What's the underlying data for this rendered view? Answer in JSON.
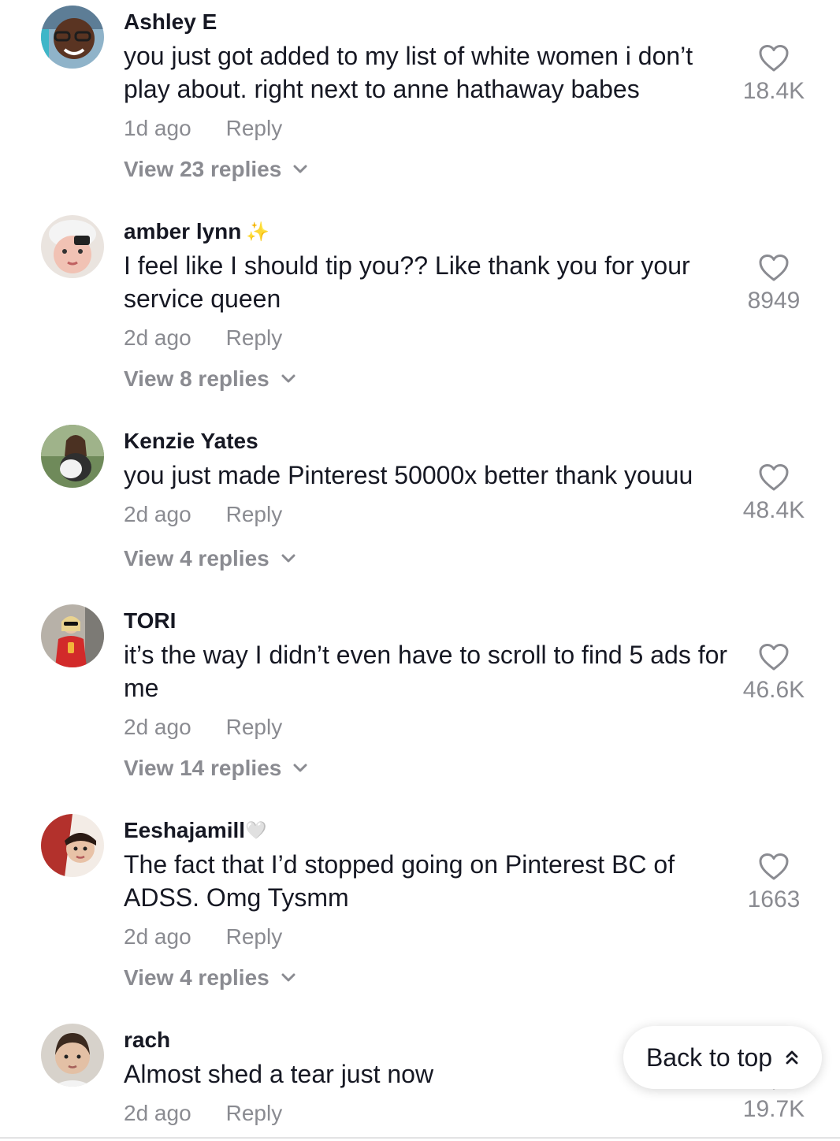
{
  "comments": [
    {
      "username": "Ashley E",
      "badge": "",
      "text": "you just got added to my list of white women i don’t play about. right next to anne hathaway babes",
      "time": "1d ago",
      "reply_label": "Reply",
      "likes": "18.4K",
      "view_replies": "View 23 replies"
    },
    {
      "username": "amber lynn",
      "badge": "✨",
      "text": "I feel like I should tip you?? Like thank you for your service queen",
      "time": "2d ago",
      "reply_label": "Reply",
      "likes": "8949",
      "view_replies": "View 8 replies"
    },
    {
      "username": "Kenzie Yates",
      "badge": "",
      "text": "you just made Pinterest 50000x better thank youuu",
      "time": "2d ago",
      "reply_label": "Reply",
      "likes": "48.4K",
      "view_replies": "View 4 replies"
    },
    {
      "username": "TORI",
      "badge": "",
      "text": "it’s the way I didn’t even have to scroll to find 5 ads for me",
      "time": "2d ago",
      "reply_label": "Reply",
      "likes": "46.6K",
      "view_replies": "View 14 replies"
    },
    {
      "username": "Eeshajamill",
      "badge": "🤍",
      "text": "The fact that I’d stopped going on Pinterest BC of ADSS. Omg Tysmm",
      "time": "2d ago",
      "reply_label": "Reply",
      "likes": "1663",
      "view_replies": "View 4 replies"
    },
    {
      "username": "rach",
      "badge": "",
      "text": "Almost shed a tear just now",
      "time": "2d ago",
      "reply_label": "Reply",
      "likes": "19.7K",
      "view_replies": ""
    }
  ],
  "back_to_top": {
    "label": "Back to top",
    "icon": "double-chevron-up-icon"
  },
  "icons": {
    "like": "heart-outline-icon",
    "expand": "chevron-down-icon"
  },
  "colors": {
    "text": "#161823",
    "secondary": "#8a8b91"
  }
}
